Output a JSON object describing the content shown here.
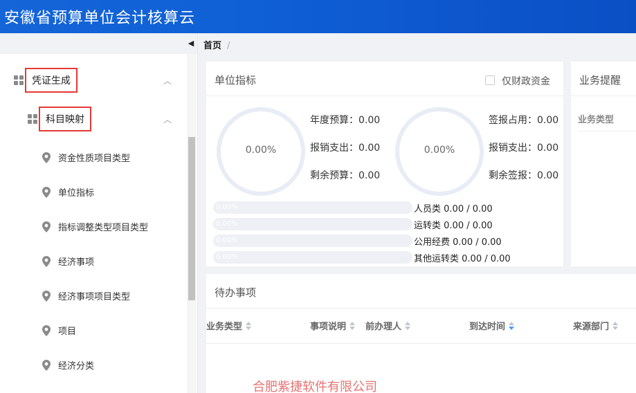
{
  "app": {
    "title": "安徽省预算单位会计核算云"
  },
  "breadcrumb": {
    "home": "首页",
    "separator": "/"
  },
  "sidebar": {
    "group1": "凭证生成",
    "group2": "科目映射",
    "items": [
      {
        "label": "资金性质项目类型"
      },
      {
        "label": "单位指标"
      },
      {
        "label": "指标调整类型项目类型"
      },
      {
        "label": "经济事项"
      },
      {
        "label": "经济事项项目类型"
      },
      {
        "label": "项目"
      },
      {
        "label": "经济分类"
      }
    ]
  },
  "unit_indicator": {
    "title": "单位指标",
    "checkbox_label": "仅财政资金",
    "ring1_percent": "0.00%",
    "ring2_percent": "0.00%",
    "ring1_value": 0,
    "ring2_value": 0,
    "left_stats": [
      {
        "label": "年度预算：",
        "value": "0.00"
      },
      {
        "label": "报销支出：",
        "value": "0.00"
      },
      {
        "label": "剩余预算：",
        "value": "0.00"
      }
    ],
    "right_stats": [
      {
        "label": "签报占用：",
        "value": "0.00"
      },
      {
        "label": "报销支出：",
        "value": "0.00"
      },
      {
        "label": "剩余签报：",
        "value": "0.00"
      }
    ],
    "bars": [
      {
        "percent": "0.00%",
        "value": 0,
        "label": "人员类",
        "amount": "0.00 / 0.00"
      },
      {
        "percent": "0.00%",
        "value": 0,
        "label": "运转类",
        "amount": "0.00 / 0.00"
      },
      {
        "percent": "0.00%",
        "value": 0,
        "label": "公用经费",
        "amount": "0.00 / 0.00"
      },
      {
        "percent": "0.00%",
        "value": 0,
        "label": "其他运转类",
        "amount": "0.00 / 0.00"
      }
    ]
  },
  "business_reminder": {
    "title": "业务提醒",
    "col_type": "业务类型"
  },
  "todo": {
    "title": "待办事项",
    "columns": [
      "业务类型",
      "事项说明",
      "前办理人",
      "到达时间",
      "来源部门"
    ]
  },
  "watermark": "合肥紫捷软件有限公司",
  "colors": {
    "topbar": "#1565d8",
    "highlight_border": "#e53935",
    "sort_active": "#409eff"
  }
}
